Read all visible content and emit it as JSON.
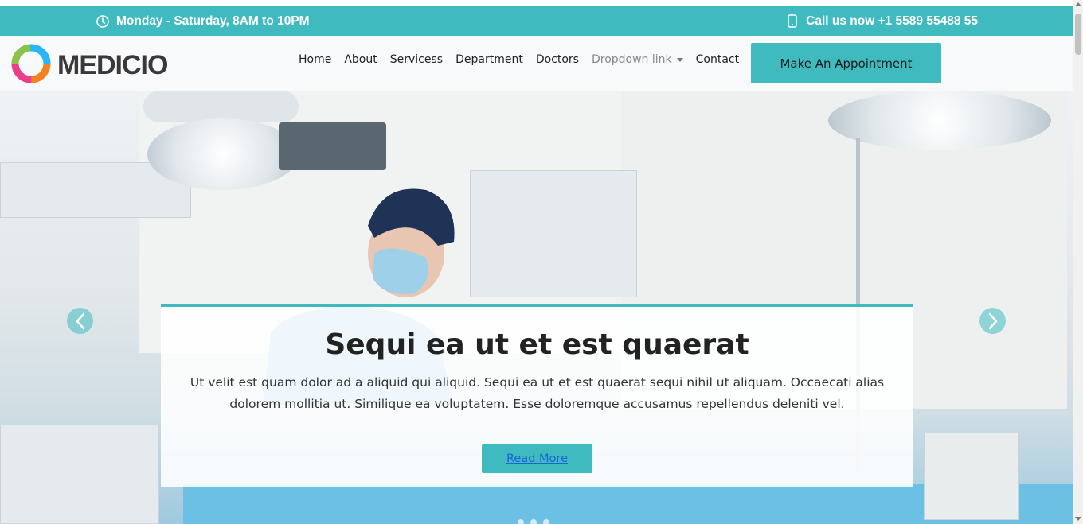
{
  "topbar": {
    "hours": "Monday - Saturday, 8AM to 10PM",
    "hours_icon": "clock-icon",
    "phone": "Call us now +1 5589 55488 55",
    "phone_icon": "phone-icon"
  },
  "header": {
    "logo_text": "MEDICIO",
    "nav": {
      "home": "Home",
      "about": "About",
      "services": "Servicess",
      "department": "Department",
      "doctors": "Doctors",
      "dropdown": "Dropdown link",
      "contact": "Contact"
    },
    "appointment_button": "Make An Appointment"
  },
  "hero": {
    "title": "Sequi ea ut et est quaerat",
    "text": "Ut velit est quam dolor ad a aliquid qui aliquid. Sequi ea ut et est quaerat sequi nihil ut aliquam. Occaecati alias dolorem mollitia ut. Similique ea voluptatem. Esse doloremque accusamus repellendus deleniti vel.",
    "read_more": "Read More",
    "prev_icon": "chevron-left-icon",
    "next_icon": "chevron-right-icon"
  },
  "colors": {
    "accent": "#3fbbc0",
    "link": "#1a64d6"
  }
}
